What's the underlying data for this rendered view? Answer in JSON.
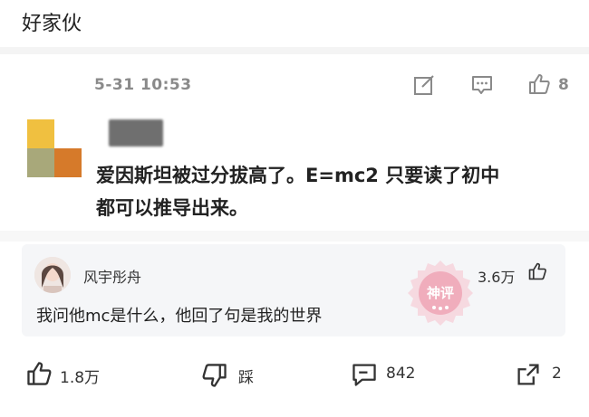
{
  "header": {
    "title": "好家伙"
  },
  "post": {
    "time": "5-31 10:53",
    "like_count": "8",
    "text_line1": "爱因斯坦被过分拔高了。E=mc2 只要读了初中",
    "text_line2": "都可以推导出来。"
  },
  "avatar_colors": [
    "#f0c040",
    "#ffffff",
    "#a8a87a",
    "#d67a2a"
  ],
  "reply": {
    "username": "风宇彤舟",
    "likes": "3.6万",
    "text": "我问他mc是什么，他回了句是我的世界"
  },
  "watermark": {
    "text": "神评"
  },
  "actions": {
    "like": "1.8万",
    "dislike": "踩",
    "comment": "842",
    "share": "2"
  }
}
